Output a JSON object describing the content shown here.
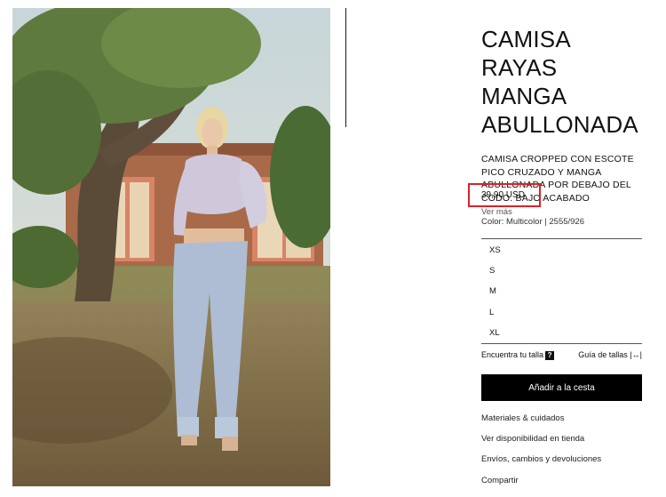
{
  "product": {
    "title": "CAMISA RAYAS MANGA ABULLONADA",
    "description": "CAMISA CROPPED CON ESCOTE PICO CRUZADO Y MANGA ABULLONADA POR DEBAJO DEL CODO. BAJO ACABADO",
    "see_more": "Ver más",
    "price": "39,90 USD",
    "color_line": "Color: Multicolor | 2555/926"
  },
  "sizes": [
    "XS",
    "S",
    "M",
    "L",
    "XL"
  ],
  "helpers": {
    "find_size": "Encuentra tu talla",
    "find_size_icon": "?",
    "size_guide": "Guía de tallas"
  },
  "cart": {
    "add_label": "Añadir a la cesta"
  },
  "links": [
    "Materiales & cuidados",
    "Ver disponibilidad en tienda",
    "Envíos, cambios y devoluciones",
    "Compartir"
  ],
  "colors": {
    "accent_highlight": "#d8232a",
    "button_bg": "#000000"
  }
}
